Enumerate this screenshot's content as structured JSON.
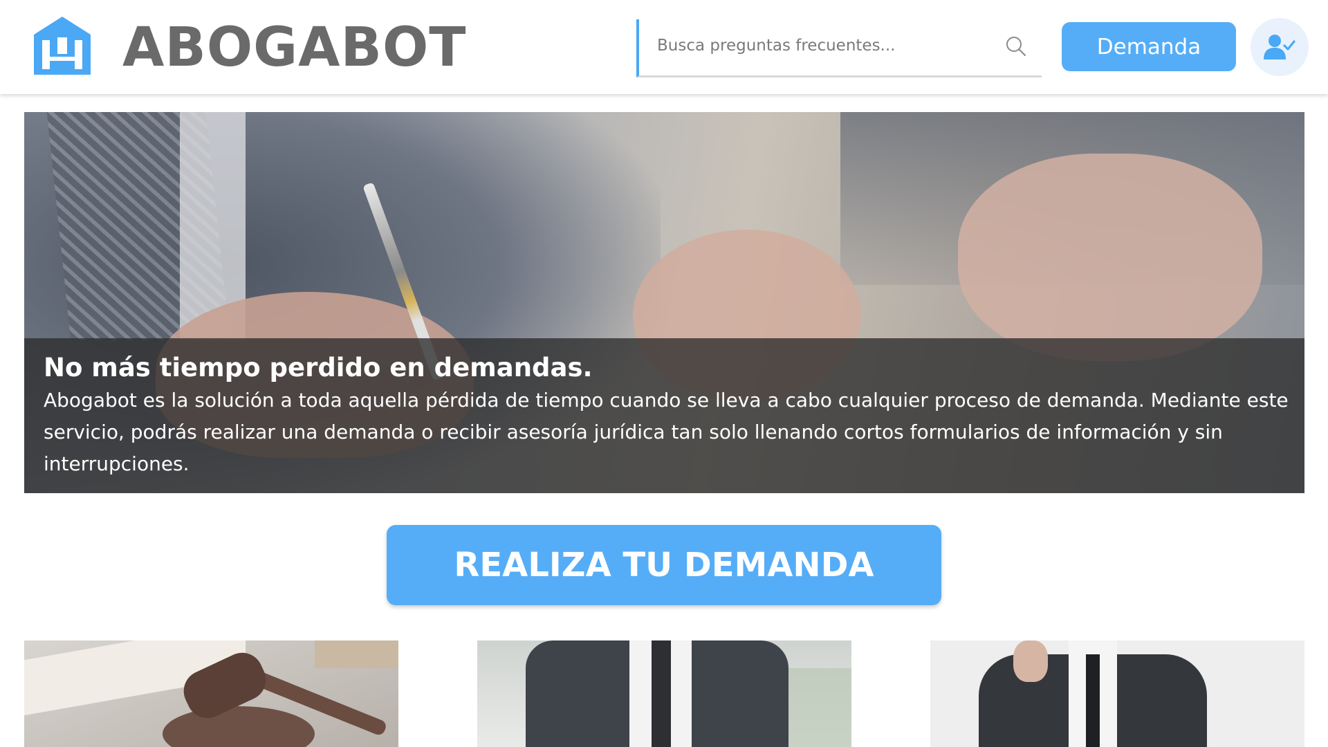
{
  "header": {
    "brand": "ABOGABOT",
    "logo_icon": "building-logo-icon",
    "search": {
      "placeholder": "Busca preguntas frecuentes...",
      "value": "",
      "icon": "search-icon"
    },
    "demanda_button_label": "Demanda",
    "user_icon": "user-check-icon"
  },
  "hero": {
    "title": "No más tiempo perdido en demandas.",
    "text": "Abogabot es la solución a toda aquella pérdida de tiempo cuando se lleva a cabo cualquier proceso de demanda. Mediante este servicio, podrás realizar una demanda o recibir asesoría jurídica tan solo llenando cortos formularios de información y sin interrupciones."
  },
  "cta": {
    "label": "REALIZA TU DEMANDA"
  },
  "colors": {
    "accent": "#55adf7",
    "brand_text": "#6a6a6a",
    "overlay": "#2d2d2d"
  }
}
